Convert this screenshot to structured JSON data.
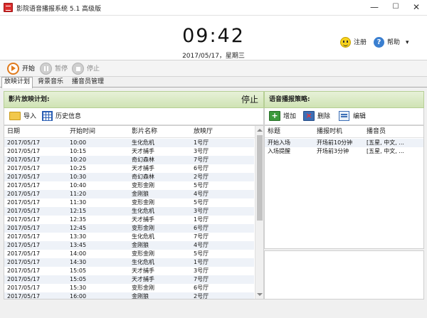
{
  "window": {
    "title": "影院语音播报系统 5.1 高级版",
    "minimize_glyph": "—",
    "maximize_glyph": "☐",
    "close_glyph": "✕"
  },
  "header": {
    "time": "09:42",
    "date": "2017/05/17，星期三",
    "register_label": "注册",
    "help_label": "帮助",
    "help_dropdown_glyph": "▾"
  },
  "toolbar": {
    "start_label": "开始",
    "pause_label": "暂停",
    "stop_label": "停止"
  },
  "tabs": [
    "放映计划",
    "背景音乐",
    "播音员管理"
  ],
  "schedule": {
    "title": "影片放映计划:",
    "status": "停止",
    "import_label": "导入",
    "history_label": "历史信息",
    "columns": [
      "日期",
      "开始时间",
      "影片名称",
      "放映厅"
    ],
    "rows": [
      [
        "2017/05/17",
        "10:00",
        "生化危机",
        "1号厅"
      ],
      [
        "2017/05/17",
        "10:15",
        "天才捕手",
        "3号厅"
      ],
      [
        "2017/05/17",
        "10:20",
        "奇幻森林",
        "7号厅"
      ],
      [
        "2017/05/17",
        "10:25",
        "天才捕手",
        "6号厅"
      ],
      [
        "2017/05/17",
        "10:30",
        "奇幻森林",
        "2号厅"
      ],
      [
        "2017/05/17",
        "10:40",
        "变形金刚",
        "5号厅"
      ],
      [
        "2017/05/17",
        "11:20",
        "金刚狼",
        "4号厅"
      ],
      [
        "2017/05/17",
        "11:30",
        "变形金刚",
        "5号厅"
      ],
      [
        "2017/05/17",
        "12:15",
        "生化危机",
        "3号厅"
      ],
      [
        "2017/05/17",
        "12:35",
        "天才捕手",
        "1号厅"
      ],
      [
        "2017/05/17",
        "12:45",
        "变形金刚",
        "6号厅"
      ],
      [
        "2017/05/17",
        "13:30",
        "生化危机",
        "7号厅"
      ],
      [
        "2017/05/17",
        "13:45",
        "金刚狼",
        "4号厅"
      ],
      [
        "2017/05/17",
        "14:00",
        "变形金刚",
        "5号厅"
      ],
      [
        "2017/05/17",
        "14:30",
        "生化危机",
        "1号厅"
      ],
      [
        "2017/05/17",
        "15:05",
        "天才捕手",
        "3号厅"
      ],
      [
        "2017/05/17",
        "15:05",
        "天才捕手",
        "7号厅"
      ],
      [
        "2017/05/17",
        "15:30",
        "变形金刚",
        "6号厅"
      ],
      [
        "2017/05/17",
        "16:00",
        "金刚狼",
        "2号厅"
      ]
    ]
  },
  "strategy": {
    "title": "语音播报策略:",
    "add_label": "增加",
    "delete_label": "删除",
    "edit_label": "编辑",
    "columns": [
      "标题",
      "播报时机",
      "播音员"
    ],
    "rows": [
      [
        "开始入场",
        "开场前10分钟",
        "[五星, 中文, ..."
      ],
      [
        "入场提醒",
        "开场前3分钟",
        "[五星, 中文, ..."
      ]
    ]
  },
  "colors": {
    "panel_header": "#d6e8be",
    "alt_row": "#eef2f8",
    "start_button": "#e07a1c",
    "disabled_button": "#bdbdbd"
  }
}
